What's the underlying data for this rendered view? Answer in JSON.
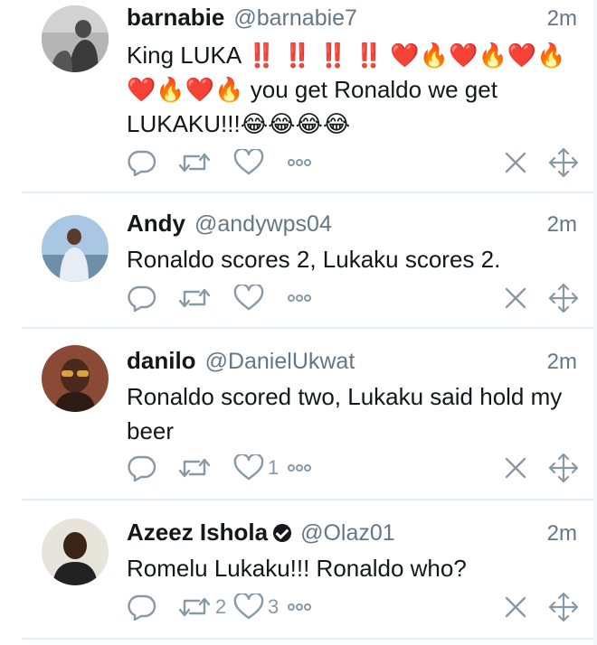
{
  "tweets": [
    {
      "name": "barnabie",
      "handle": "@barnabie7",
      "time": "2m",
      "text_lines": [
        "King LUKA",
        "",
        "you get Ronaldo we get",
        "LUKAKU!!!"
      ],
      "emoji_row1": "‼️ ‼️ ‼️ ‼️ ❤️🔥❤️🔥❤️🔥",
      "emoji_row2": "❤️🔥❤️🔥",
      "emoji_end": "😂😂😂😂",
      "retweets": "",
      "likes": ""
    },
    {
      "name": "Andy",
      "handle": "@andywps04",
      "time": "2m",
      "text": "Ronaldo scores 2, Lukaku scores 2.",
      "retweets": "",
      "likes": ""
    },
    {
      "name": "danilo",
      "handle": "@DanielUkwat",
      "time": "2m",
      "text": "Ronaldo scored two, Lukaku said hold my beer",
      "retweets": "",
      "likes": "1"
    },
    {
      "name": "Azeez Ishola",
      "handle": "@Olaz01",
      "time": "2m",
      "text": "Romelu Lukaku!!! Ronaldo who?",
      "verified": true,
      "retweets": "2",
      "likes": "3"
    }
  ],
  "icons": {
    "reply": "reply-icon",
    "retweet": "retweet-icon",
    "like": "heart-icon",
    "more": "more-dots-icon",
    "dismiss": "close-icon",
    "move": "move-arrows-icon"
  },
  "colors": {
    "text": "#14171a",
    "secondary": "#657786",
    "icon": "#8899a6",
    "divider": "#e6ecf0"
  }
}
